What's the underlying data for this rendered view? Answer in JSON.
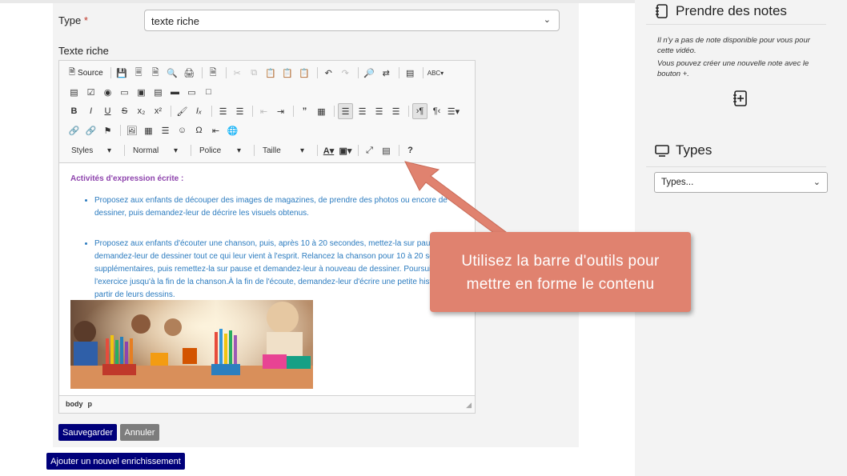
{
  "form": {
    "type_label": "Type",
    "required_mark": "*",
    "type_value": "texte riche",
    "richtext_label": "Texte riche"
  },
  "editor": {
    "toolbar": {
      "source_label": "Source",
      "combos": [
        "Styles",
        "Normal",
        "Police",
        "Taille"
      ]
    },
    "content": {
      "heading": "Activités d'expression écrite :",
      "bullets": [
        "Proposez aux enfants de découper des images de magazines, de prendre des photos ou encore de dessiner, puis demandez-leur de décrire les visuels obtenus.",
        "Proposez aux enfants d'écouter une chanson, puis, après 10 à 20 secondes, mettez-la sur pause et demandez-leur de dessiner tout ce qui leur vient à l'esprit. Relancez la chanson pour 10 à 20 secondes supplémentaires, puis remettez-la sur pause et demandez-leur à nouveau de dessiner. Poursuivez l'exercice jusqu'à la fin de la chanson.À la fin de l'écoute, demandez-leur d'écrire une petite histoire à partir de leurs dessins."
      ]
    },
    "status_path": [
      "body",
      "p"
    ]
  },
  "buttons": {
    "save": "Sauvegarder",
    "cancel": "Annuler",
    "add": "Ajouter un nouvel enrichissement"
  },
  "callout": {
    "text": "Utilisez la barre d'outils pour mettre en forme le contenu"
  },
  "sidebar": {
    "notes_title": "Prendre des notes",
    "notes_empty_1": "Il n'y a pas de note disponible pour vous pour cette vidéo.",
    "notes_empty_2": "Vous pouvez créer une nouvelle note avec le bouton +.",
    "types_title": "Types",
    "types_select": "Types..."
  },
  "colors": {
    "primary_button": "#00007a",
    "callout": "#e0826f",
    "heading_purple": "#8e44ad",
    "text_blue": "#2b7bbf"
  }
}
